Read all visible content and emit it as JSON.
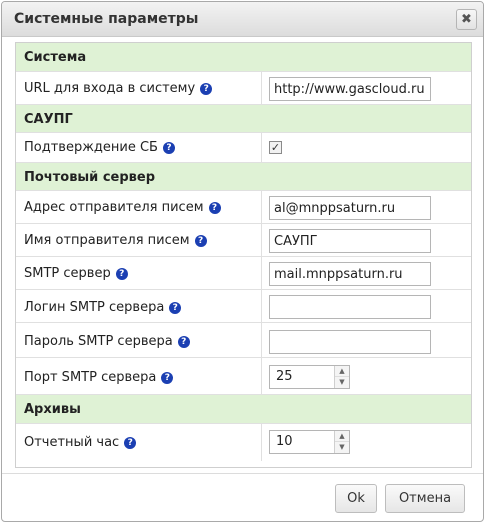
{
  "dialog": {
    "title": "Системные параметры",
    "close_glyph": "✖"
  },
  "help_glyph": "?",
  "sections": {
    "system": "Система",
    "saupg": "САУПГ",
    "mail": "Почтовый сервер",
    "archives": "Архивы"
  },
  "fields": {
    "login_url": {
      "label": "URL для входа в систему",
      "value": "http://www.gascloud.ru"
    },
    "sb_confirm": {
      "label": "Подтверждение СБ",
      "checked": true,
      "check_glyph": "✓"
    },
    "sender_address": {
      "label": "Адрес отправителя писем",
      "value": "al@mnppsaturn.ru"
    },
    "sender_name": {
      "label": "Имя отправителя писем",
      "value": "САУПГ"
    },
    "smtp_server": {
      "label": "SMTP сервер",
      "value": "mail.mnppsaturn.ru"
    },
    "smtp_login": {
      "label": "Логин SMTP сервера",
      "value": ""
    },
    "smtp_password": {
      "label": "Пароль SMTP сервера",
      "value": ""
    },
    "smtp_port": {
      "label": "Порт SMTP сервера",
      "value": "25"
    },
    "report_hour": {
      "label": "Отчетный час",
      "value": "10"
    }
  },
  "spinner": {
    "up_glyph": "▲",
    "down_glyph": "▼"
  },
  "buttons": {
    "ok": "Ok",
    "cancel": "Отмена"
  }
}
